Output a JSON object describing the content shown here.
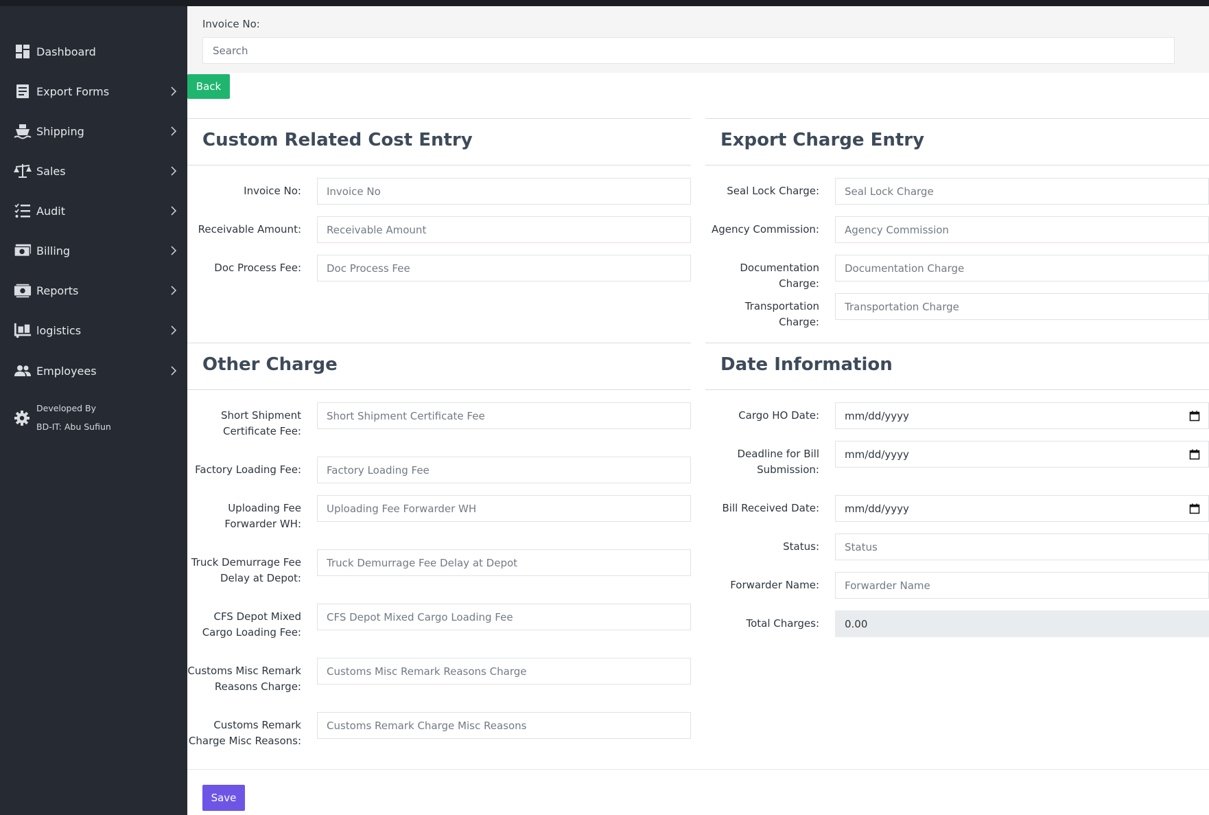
{
  "sidebar": {
    "items": [
      {
        "label": "Dashboard",
        "icon": "dashboard-icon"
      },
      {
        "label": "Export Forms",
        "icon": "form-icon"
      },
      {
        "label": "Shipping",
        "icon": "ship-icon"
      },
      {
        "label": "Sales",
        "icon": "scale-icon"
      },
      {
        "label": "Audit",
        "icon": "checklist-icon"
      },
      {
        "label": "Billing",
        "icon": "money-icon"
      },
      {
        "label": "Reports",
        "icon": "money-cycle-icon"
      },
      {
        "label": "logistics",
        "icon": "dolly-icon"
      },
      {
        "label": "Employees",
        "icon": "users-icon"
      }
    ],
    "developer": {
      "line1": "Developed By",
      "line2": "BD-IT: Abu Sufiun"
    }
  },
  "search": {
    "label": "Invoice No:",
    "placeholder": "Search"
  },
  "back_label": "Back",
  "custom_cost": {
    "title": "Custom Related Cost Entry",
    "fields": [
      {
        "label": "Invoice No:",
        "placeholder": "Invoice No"
      },
      {
        "label": "Receivable Amount:",
        "placeholder": "Receivable Amount"
      },
      {
        "label": "Doc Process Fee:",
        "placeholder": "Doc Process Fee"
      }
    ]
  },
  "export_charge": {
    "title": "Export Charge Entry",
    "fields": [
      {
        "label": "Seal Lock Charge:",
        "placeholder": "Seal Lock Charge"
      },
      {
        "label": "Agency Commission:",
        "placeholder": "Agency Commission"
      },
      {
        "label": "Documentation Charge:",
        "placeholder": "Documentation Charge"
      },
      {
        "label": "Transportation Charge:",
        "placeholder": "Transportation Charge"
      }
    ]
  },
  "other_charge": {
    "title": "Other Charge",
    "fields": [
      {
        "label1": "Short Shipment",
        "label2": "Certificate Fee:",
        "placeholder": "Short Shipment Certificate Fee"
      },
      {
        "label1": "Factory Loading Fee:",
        "label2": "",
        "placeholder": "Factory Loading Fee"
      },
      {
        "label1": "Uploading Fee",
        "label2": "Forwarder WH:",
        "placeholder": "Uploading Fee Forwarder WH"
      },
      {
        "label1": "Truck Demurrage Fee",
        "label2": "Delay at Depot:",
        "placeholder": "Truck Demurrage Fee Delay at Depot"
      },
      {
        "label1": "CFS Depot Mixed",
        "label2": "Cargo Loading Fee:",
        "placeholder": "CFS Depot Mixed Cargo Loading Fee"
      },
      {
        "label1": "Customs Misc Remark",
        "label2": "Reasons Charge:",
        "placeholder": "Customs Misc Remark Reasons Charge"
      },
      {
        "label1": "Customs Remark",
        "label2": "Charge Misc Reasons:",
        "placeholder": "Customs Remark Charge Misc Reasons"
      }
    ]
  },
  "date_info": {
    "title": "Date Information",
    "dates": [
      {
        "label1": "Cargo HO Date:",
        "label2": "",
        "value": "mm/dd/yyyy"
      },
      {
        "label1": "Deadline for Bill",
        "label2": "Submission:",
        "value": "mm/dd/yyyy"
      },
      {
        "label1": "Bill Received Date:",
        "label2": "",
        "value": "mm/dd/yyyy"
      }
    ],
    "status": {
      "label": "Status:",
      "placeholder": "Status"
    },
    "forwarder": {
      "label": "Forwarder Name:",
      "placeholder": "Forwarder Name"
    },
    "total": {
      "label": "Total Charges:",
      "value": "0.00"
    }
  },
  "save_label": "Save"
}
